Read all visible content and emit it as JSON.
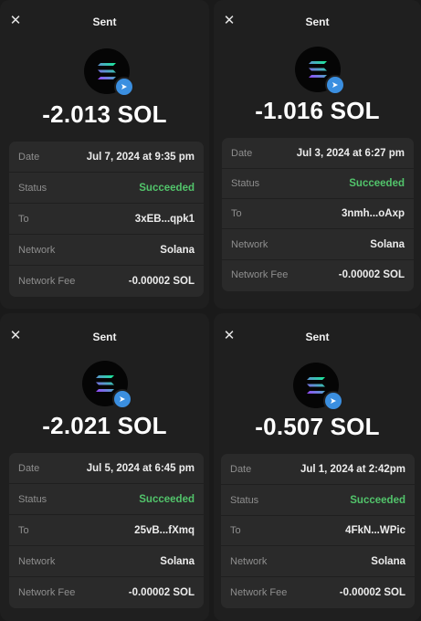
{
  "screens": [
    {
      "title": "Sent",
      "amount": "-2.013 SOL",
      "rows": [
        {
          "label": "Date",
          "value": "Jul 7, 2024 at 9:35 pm"
        },
        {
          "label": "Status",
          "value": "Succeeded"
        },
        {
          "label": "To",
          "value": "3xEB...qpk1"
        },
        {
          "label": "Network",
          "value": "Solana"
        },
        {
          "label": "Network Fee",
          "value": "-0.00002 SOL"
        }
      ]
    },
    {
      "title": "Sent",
      "amount": "-1.016 SOL",
      "rows": [
        {
          "label": "Date",
          "value": "Jul 3, 2024 at 6:27 pm"
        },
        {
          "label": "Status",
          "value": "Succeeded"
        },
        {
          "label": "To",
          "value": "3nmh...oAxp"
        },
        {
          "label": "Network",
          "value": "Solana"
        },
        {
          "label": "Network Fee",
          "value": "-0.00002 SOL"
        }
      ]
    },
    {
      "title": "Sent",
      "amount": "-2.021 SOL",
      "rows": [
        {
          "label": "Date",
          "value": "Jul 5, 2024 at 6:45 pm"
        },
        {
          "label": "Status",
          "value": "Succeeded"
        },
        {
          "label": "To",
          "value": "25vB...fXmq"
        },
        {
          "label": "Network",
          "value": "Solana"
        },
        {
          "label": "Network Fee",
          "value": "-0.00002 SOL"
        }
      ]
    },
    {
      "title": "Sent",
      "amount": "-0.507 SOL",
      "rows": [
        {
          "label": "Date",
          "value": "Jul 1, 2024 at 2:42pm"
        },
        {
          "label": "Status",
          "value": "Succeeded"
        },
        {
          "label": "To",
          "value": "4FkN...WPic"
        },
        {
          "label": "Network",
          "value": "Solana"
        },
        {
          "label": "Network Fee",
          "value": "-0.00002 SOL"
        }
      ]
    }
  ],
  "icons": {
    "close": "close-icon",
    "token": "solana-logo-icon",
    "sent_badge": "sent-arrow-icon"
  },
  "colors": {
    "success": "#52c46b",
    "badge": "#3b8fe0"
  }
}
